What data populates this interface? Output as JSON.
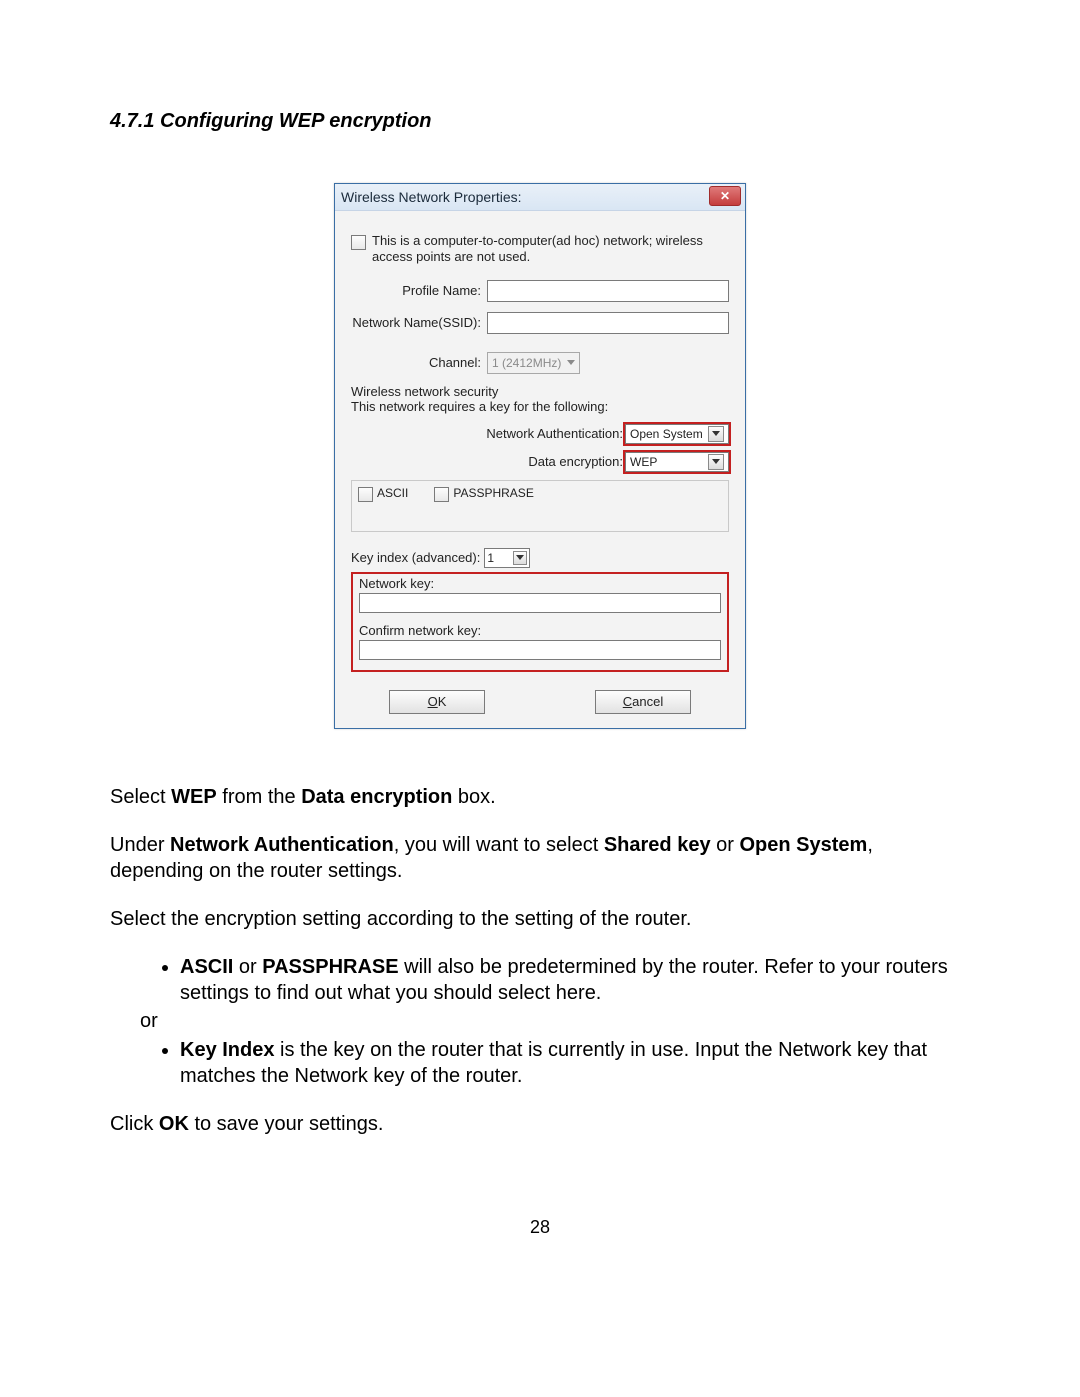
{
  "section_title": "4.7.1 Configuring WEP encryption",
  "dialog": {
    "title": "Wireless Network Properties:",
    "close_label": "✕",
    "adhoc_text": "This is a computer-to-computer(ad hoc) network; wireless access points are not used.",
    "profile_name_label": "Profile Name:",
    "ssid_label": "Network Name(SSID):",
    "channel_label": "Channel:",
    "channel_value": "1 (2412MHz)",
    "security_header": "Wireless network security",
    "security_desc": "This network requires a key for the following:",
    "auth_label": "Network Authentication:",
    "auth_value": "Open System",
    "enc_label": "Data encryption:",
    "enc_value": "WEP",
    "ascii_label": "ASCII",
    "passphrase_label": "PASSPHRASE",
    "keyindex_label": "Key index (advanced):",
    "keyindex_value": "1",
    "netkey_label": "Network key:",
    "confirmkey_label": "Confirm network key:",
    "ok_prefix": "O",
    "ok_rest": "K",
    "cancel_prefix": "C",
    "cancel_rest": "ancel"
  },
  "instructions": {
    "p1_a": "Select ",
    "p1_b": "WEP",
    "p1_c": " from the ",
    "p1_d": "Data encryption",
    "p1_e": " box.",
    "p2_a": "Under ",
    "p2_b": "Network Authentication",
    "p2_c": ", you will want to select ",
    "p2_d": "Shared key",
    "p2_e": " or ",
    "p2_f": "Open System",
    "p2_g": ", depending on the router settings.",
    "p3": "Select the encryption setting according to the setting of the router.",
    "li1_a": "ASCII",
    "li1_b": "  or  ",
    "li1_c": "PASSPHRASE",
    "li1_d": " will also be predetermined by the router. Refer to your routers settings to find out what you should select here.",
    "or": "or",
    "li2_a": "Key Index",
    "li2_b": " is the key on the router that is currently in use. Input the Network key that matches the Network key of the router.",
    "p4_a": "Click ",
    "p4_b": "OK",
    "p4_c": " to save your settings."
  },
  "page_number": "28"
}
